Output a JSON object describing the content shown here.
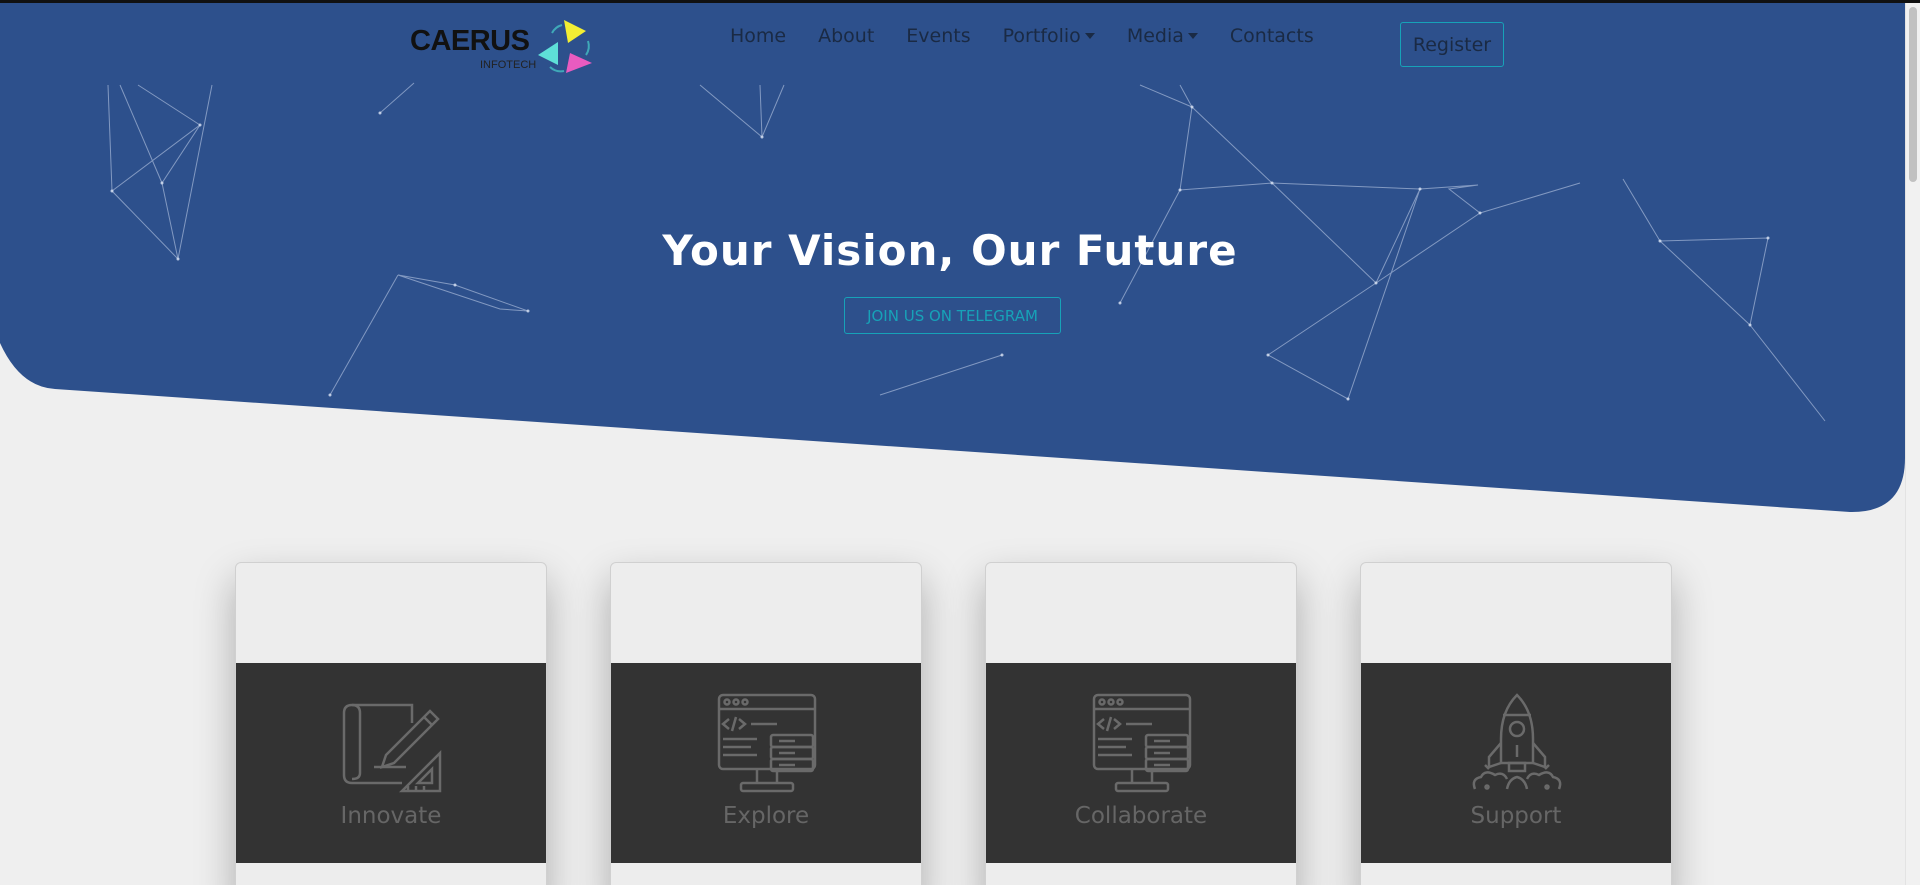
{
  "colors": {
    "hero_blue": "#2d508c",
    "accent_teal": "#17a2b8",
    "card_dark": "#333333",
    "page_bg": "#efefef"
  },
  "brand": {
    "name": "CAERUS",
    "subtitle": "INFOTECH"
  },
  "nav": {
    "items": [
      {
        "label": "Home",
        "dropdown": false
      },
      {
        "label": "About",
        "dropdown": false
      },
      {
        "label": "Events",
        "dropdown": false
      },
      {
        "label": "Portfolio",
        "dropdown": true
      },
      {
        "label": "Media",
        "dropdown": true
      },
      {
        "label": "Contacts",
        "dropdown": false
      }
    ],
    "register_label": "Register"
  },
  "hero": {
    "title": "Your Vision, Our Future",
    "cta_label": "JOIN US ON TELEGRAM"
  },
  "cards": [
    {
      "label": "Innovate",
      "icon": "blueprint-pencil-icon"
    },
    {
      "label": "Explore",
      "icon": "code-monitor-icon"
    },
    {
      "label": "Collaborate",
      "icon": "code-monitor-icon"
    },
    {
      "label": "Support",
      "icon": "rocket-icon"
    }
  ]
}
